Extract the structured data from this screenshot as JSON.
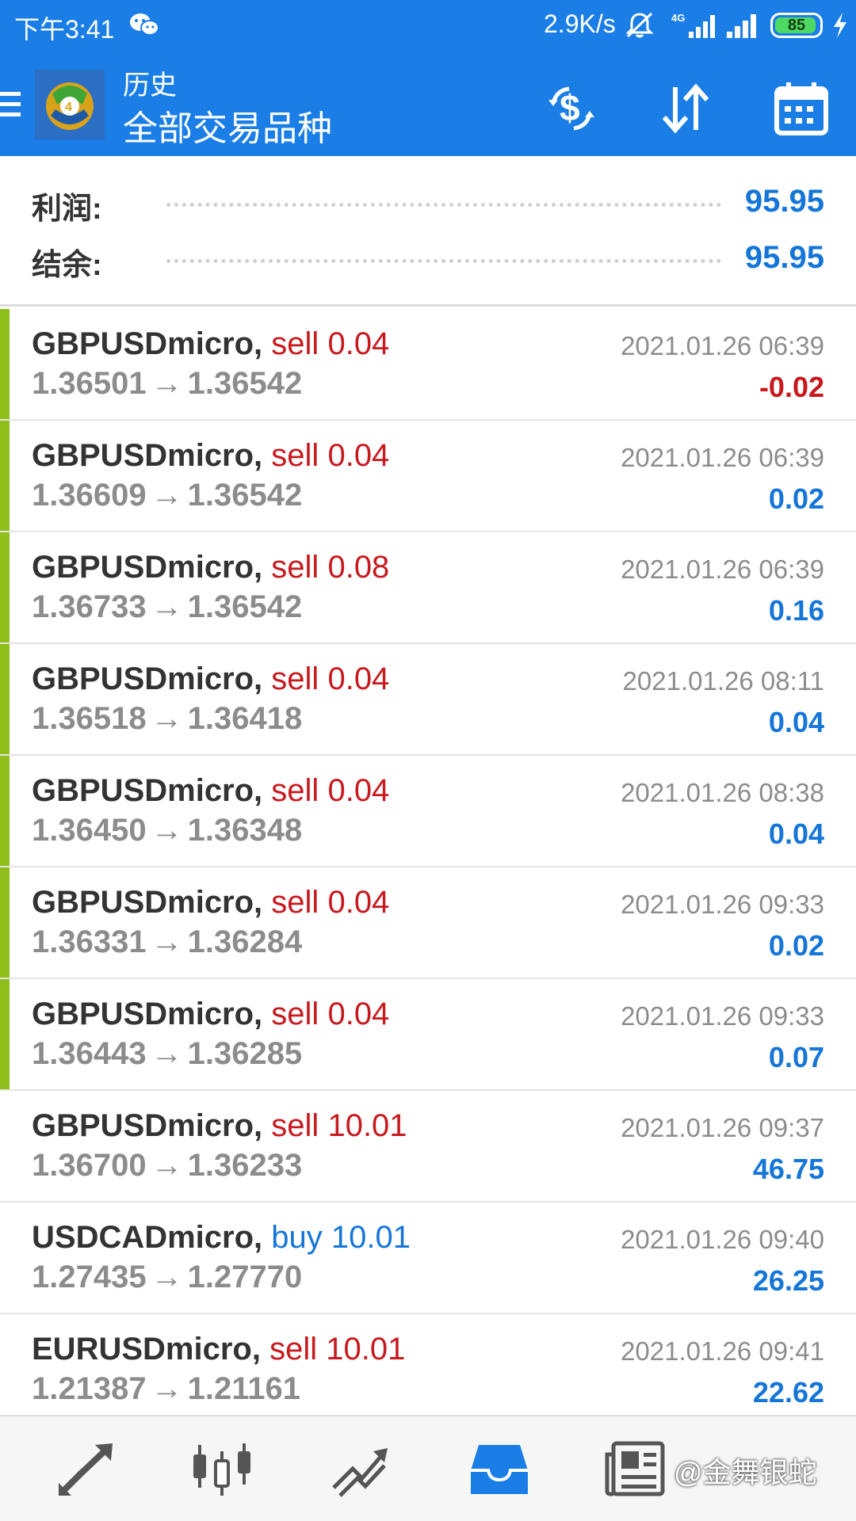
{
  "status_bar": {
    "time": "下午3:41",
    "net_speed": "2.9K/s",
    "battery": "85",
    "icons": [
      "wechat-icon",
      "mute-icon",
      "4g-icon",
      "signal-icon",
      "battery-icon",
      "charging-icon"
    ]
  },
  "app_bar": {
    "subtitle": "历史",
    "title": "全部交易品种",
    "actions": [
      "currency-icon",
      "sort-icon",
      "calendar-icon"
    ],
    "accent_color": "#1a7ee6"
  },
  "summary": {
    "profit_label": "利润:",
    "profit_value": "95.95",
    "balance_label": "结余:",
    "balance_value": "95.95"
  },
  "colors": {
    "sell": "#c8191e",
    "buy": "#1576d8",
    "positive": "#1576d8",
    "negative": "#c8191e",
    "marker": "#8fbf1a"
  },
  "history": [
    {
      "symbol": "GBPUSDmicro,",
      "side": "sell",
      "volume": "0.04",
      "open": "1.36501",
      "close": "1.36542",
      "time": "2021.01.26 06:39",
      "profit": "-0.02",
      "marked": true
    },
    {
      "symbol": "GBPUSDmicro,",
      "side": "sell",
      "volume": "0.04",
      "open": "1.36609",
      "close": "1.36542",
      "time": "2021.01.26 06:39",
      "profit": "0.02",
      "marked": true
    },
    {
      "symbol": "GBPUSDmicro,",
      "side": "sell",
      "volume": "0.08",
      "open": "1.36733",
      "close": "1.36542",
      "time": "2021.01.26 06:39",
      "profit": "0.16",
      "marked": true
    },
    {
      "symbol": "GBPUSDmicro,",
      "side": "sell",
      "volume": "0.04",
      "open": "1.36518",
      "close": "1.36418",
      "time": "2021.01.26 08:11",
      "profit": "0.04",
      "marked": true
    },
    {
      "symbol": "GBPUSDmicro,",
      "side": "sell",
      "volume": "0.04",
      "open": "1.36450",
      "close": "1.36348",
      "time": "2021.01.26 08:38",
      "profit": "0.04",
      "marked": true
    },
    {
      "symbol": "GBPUSDmicro,",
      "side": "sell",
      "volume": "0.04",
      "open": "1.36331",
      "close": "1.36284",
      "time": "2021.01.26 09:33",
      "profit": "0.02",
      "marked": true
    },
    {
      "symbol": "GBPUSDmicro,",
      "side": "sell",
      "volume": "0.04",
      "open": "1.36443",
      "close": "1.36285",
      "time": "2021.01.26 09:33",
      "profit": "0.07",
      "marked": true
    },
    {
      "symbol": "GBPUSDmicro,",
      "side": "sell",
      "volume": "10.01",
      "open": "1.36700",
      "close": "1.36233",
      "time": "2021.01.26 09:37",
      "profit": "46.75",
      "marked": false
    },
    {
      "symbol": "USDCADmicro,",
      "side": "buy",
      "volume": "10.01",
      "open": "1.27435",
      "close": "1.27770",
      "time": "2021.01.26 09:40",
      "profit": "26.25",
      "marked": false
    },
    {
      "symbol": "EURUSDmicro,",
      "side": "sell",
      "volume": "10.01",
      "open": "1.21387",
      "close": "1.21161",
      "time": "2021.01.26 09:41",
      "profit": "22.62",
      "marked": false
    }
  ],
  "arrow_glyph": "→",
  "bottom_nav": {
    "items": [
      "quotes-icon",
      "chart-icon",
      "trade-icon",
      "history-icon",
      "news-icon"
    ],
    "active": "history-icon",
    "active_color": "#1a7ee6"
  },
  "watermark": "@金舞银蛇"
}
